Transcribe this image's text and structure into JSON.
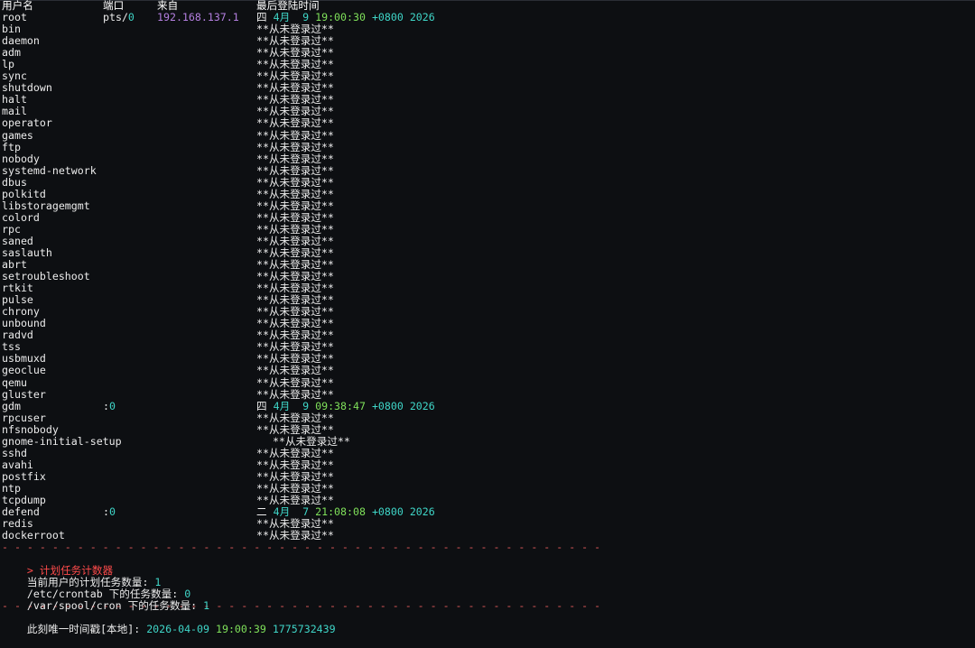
{
  "window": {
    "background": "#0d0f12",
    "accent_teal": "#3fd6c8",
    "accent_green": "#7fe05a",
    "accent_purple": "#b47fe0",
    "accent_red": "#ff4b4b"
  },
  "lastlog": {
    "headers": {
      "user": "用户名",
      "port": "端口",
      "from": "来自",
      "last": "最后登陆时间"
    },
    "never": "**从未登录过**",
    "rows": [
      {
        "user": "root",
        "port": "pts/0",
        "from": "192.168.137.1",
        "wd": "四",
        "mon": "4月",
        "day": "9",
        "time": "19:00:30",
        "tz": "+0800",
        "year": "2026"
      },
      {
        "user": "bin"
      },
      {
        "user": "daemon"
      },
      {
        "user": "adm"
      },
      {
        "user": "lp"
      },
      {
        "user": "sync"
      },
      {
        "user": "shutdown"
      },
      {
        "user": "halt"
      },
      {
        "user": "mail"
      },
      {
        "user": "operator"
      },
      {
        "user": "games"
      },
      {
        "user": "ftp"
      },
      {
        "user": "nobody"
      },
      {
        "user": "systemd-network"
      },
      {
        "user": "dbus"
      },
      {
        "user": "polkitd"
      },
      {
        "user": "libstoragemgmt"
      },
      {
        "user": "colord"
      },
      {
        "user": "rpc"
      },
      {
        "user": "saned"
      },
      {
        "user": "saslauth"
      },
      {
        "user": "abrt"
      },
      {
        "user": "setroubleshoot"
      },
      {
        "user": "rtkit"
      },
      {
        "user": "pulse"
      },
      {
        "user": "chrony"
      },
      {
        "user": "unbound"
      },
      {
        "user": "radvd"
      },
      {
        "user": "tss"
      },
      {
        "user": "usbmuxd"
      },
      {
        "user": "geoclue"
      },
      {
        "user": "qemu"
      },
      {
        "user": "gluster"
      },
      {
        "user": "gdm",
        "port": ":0",
        "wd": "四",
        "mon": "4月",
        "day": "9",
        "time": "09:38:47",
        "tz": "+0800",
        "year": "2026"
      },
      {
        "user": "rpcuser"
      },
      {
        "user": "nfsnobody"
      },
      {
        "user": "gnome-initial-setup",
        "shifted": true
      },
      {
        "user": "sshd"
      },
      {
        "user": "avahi"
      },
      {
        "user": "postfix"
      },
      {
        "user": "ntp"
      },
      {
        "user": "tcpdump"
      },
      {
        "user": "defend",
        "port": ":0",
        "wd": "二",
        "mon": "4月",
        "day": "7",
        "time": "21:08:08",
        "tz": "+0800",
        "year": "2026"
      },
      {
        "user": "redis"
      },
      {
        "user": "dockerroot"
      }
    ]
  },
  "separator": "- - - - - - - - - - - - - - - - - - - - - - - - - - - - - - - - - - - - - - - - - - - - - - - - - - - - - - - - - - - - - - - - - - - - - - - - - - - - - - - - - - - - - - - - - - - - - - - - - - - - - - - - - - - - - - - - - - - - - - - - - - - - - - - - - - -",
  "cron": {
    "title": "> 计划任务计数器",
    "lines": [
      {
        "label": "当前用户的计划任务数量: ",
        "value": "1"
      },
      {
        "label": "/etc/crontab 下的任务数量: ",
        "value": "0"
      },
      {
        "label": "/var/spool/cron 下的任务数量: ",
        "value": "1"
      }
    ]
  },
  "timestamp": {
    "label": "此刻唯一时间戳[本地]: ",
    "date": "2026-04-09",
    "time": "19:00:39",
    "epoch": "1775732439"
  }
}
